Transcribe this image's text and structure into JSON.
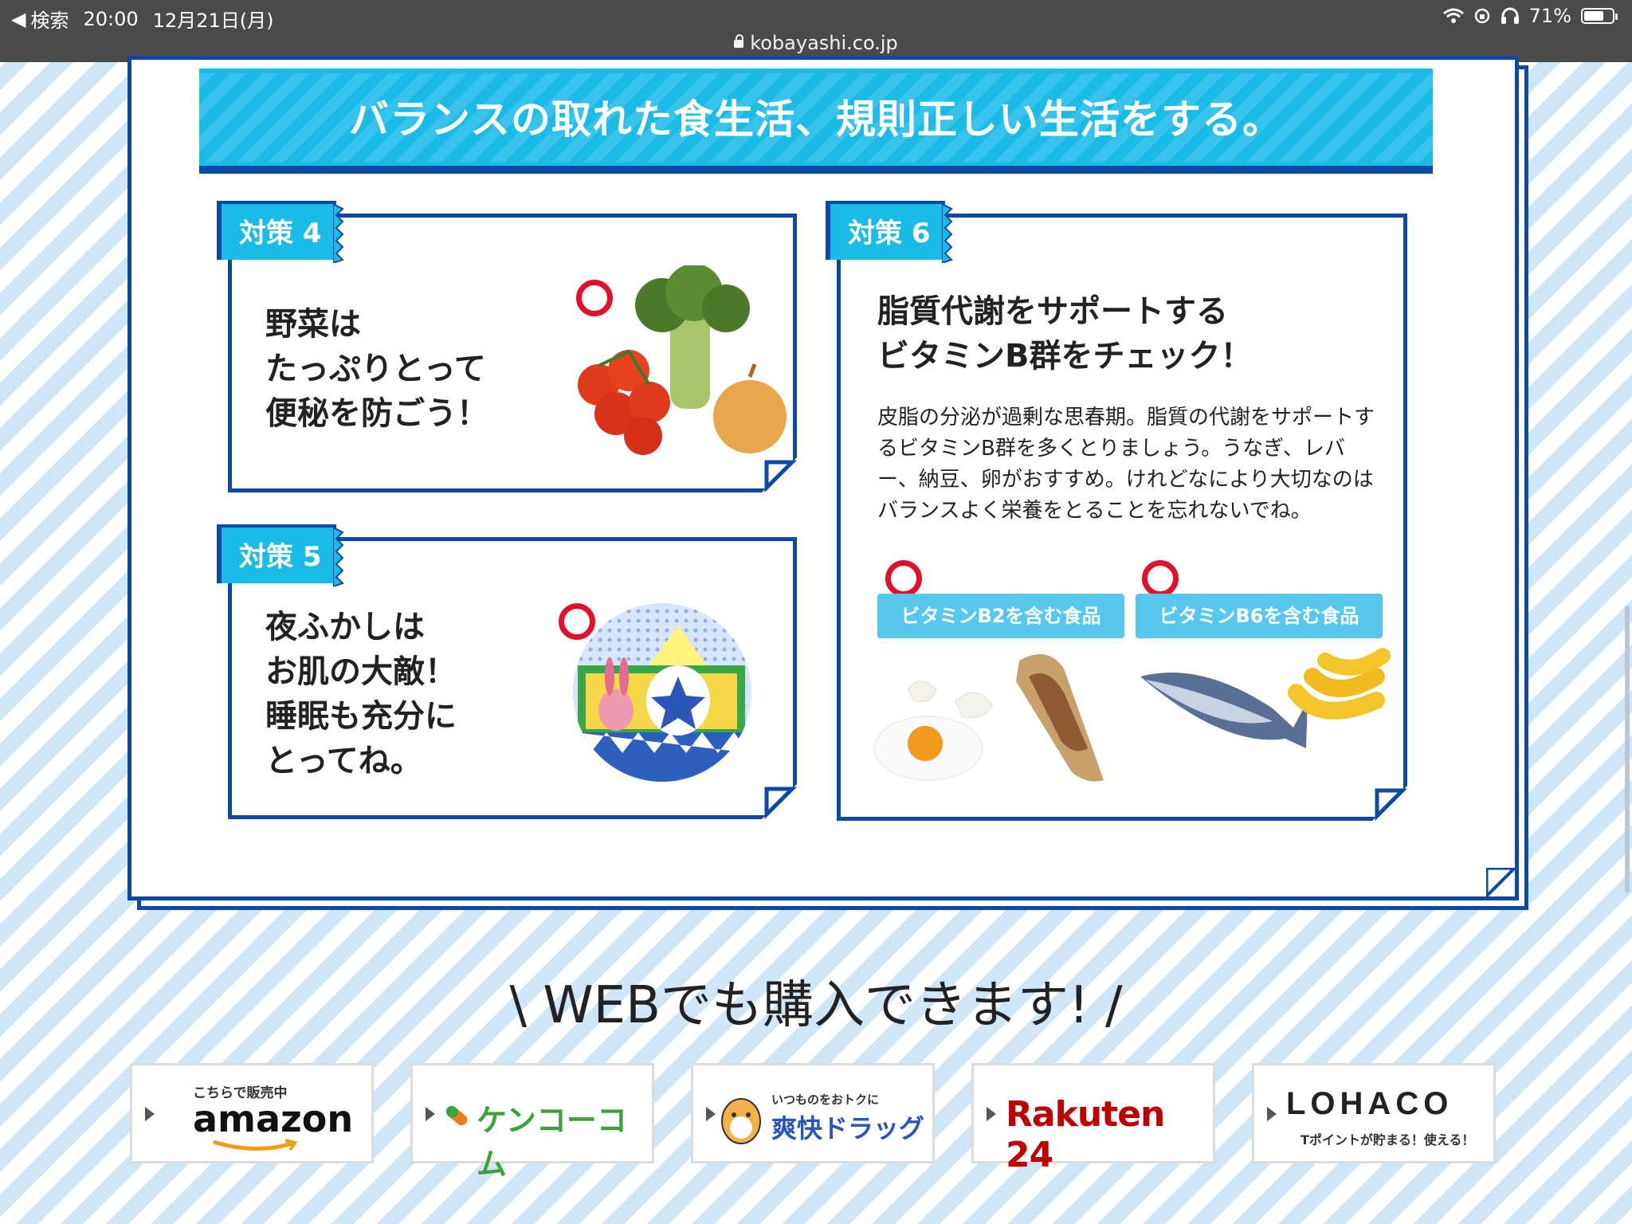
{
  "status_bar": {
    "back_label": "検索",
    "time": "20:00",
    "date": "12月21日(月)",
    "battery": "71%",
    "battery_level": 0.71
  },
  "address_bar": {
    "url": "kobayashi.co.jp"
  },
  "banner": {
    "title": "バランスの取れた食生活、規則正しい生活をする。"
  },
  "cards": {
    "c4": {
      "tag": "対策 4",
      "title": "野菜は\nたっぷりとって\n便秘を防ごう！"
    },
    "c5": {
      "tag": "対策 5",
      "title": "夜ふかしは\nお肌の大敵！\n睡眠も充分に\nとってね。"
    },
    "c6": {
      "tag": "対策 6",
      "title": "脂質代謝をサポートする\nビタミンB群をチェック！",
      "body": "皮脂の分泌が過剰な思春期。脂質の代謝をサポートするビタミンB群を多くとりましょう。うなぎ、レバー、納豆、卵がおすすめ。けれどなにより大切なのはバランスよく栄養をとることを忘れないでね。",
      "pill_b2": "ビタミンB2を含む食品",
      "pill_b6": "ビタミンB6を含む食品"
    }
  },
  "web_purchase": {
    "title": "\\ WEBでも購入できます! /",
    "shops": {
      "amazon_small": "こちらで販売中",
      "amazon": "amazon",
      "kenko": "ケンコーコム",
      "sokai_small": "いつものをおトクに",
      "sokai": "爽快ドラッグ",
      "rakuten": "Rakuten 24",
      "lohaco": "LOHACO",
      "lohaco_small": "Tポイントが貯まる！使える！"
    }
  },
  "colors": {
    "navy": "#0d49a6",
    "cyan": "#1bbbe8",
    "pill": "#58c7ef",
    "red": "#e3102c"
  }
}
